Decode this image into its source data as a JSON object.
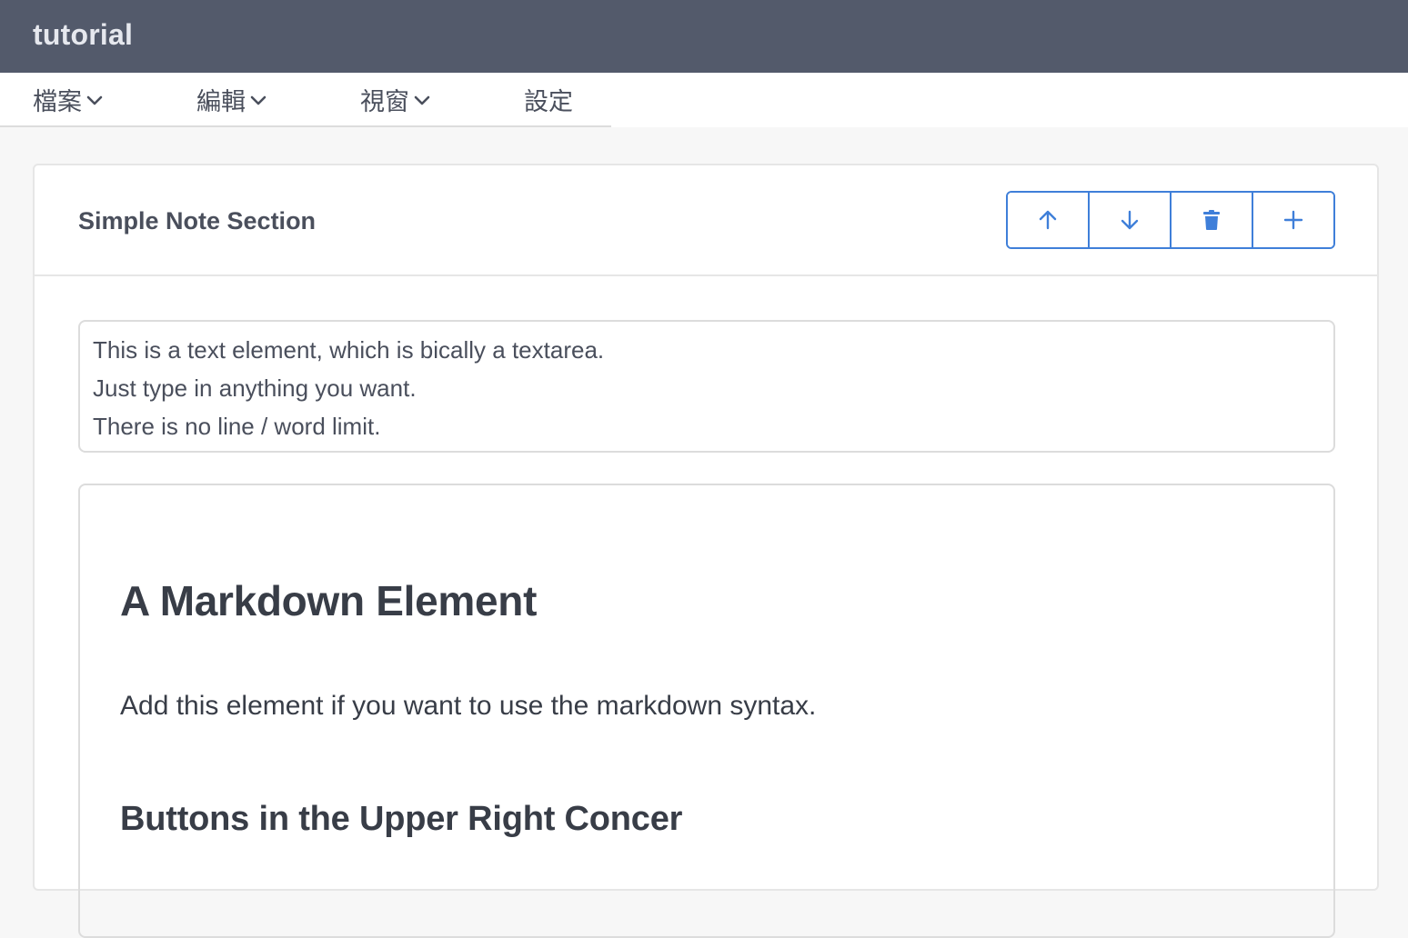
{
  "app": {
    "title": "tutorial"
  },
  "menu": {
    "items": [
      {
        "label": "檔案",
        "has_dropdown": true
      },
      {
        "label": "編輯",
        "has_dropdown": true
      },
      {
        "label": "視窗",
        "has_dropdown": true
      },
      {
        "label": "設定",
        "has_dropdown": false
      }
    ]
  },
  "section": {
    "title": "Simple Note Section",
    "buttons": [
      {
        "icon": "arrow-up-icon"
      },
      {
        "icon": "arrow-down-icon"
      },
      {
        "icon": "trash-icon"
      },
      {
        "icon": "plus-icon"
      }
    ],
    "accent_color": "#3f7fd9"
  },
  "text_element": {
    "lines": [
      "This is a text element, which is bically a textarea.",
      "Just type in anything you want.",
      "There is no line / word limit."
    ]
  },
  "markdown_element": {
    "h1": "A Markdown Element",
    "paragraph": "Add this element if you want to use the markdown syntax.",
    "h2": "Buttons in the Upper Right Concer"
  }
}
